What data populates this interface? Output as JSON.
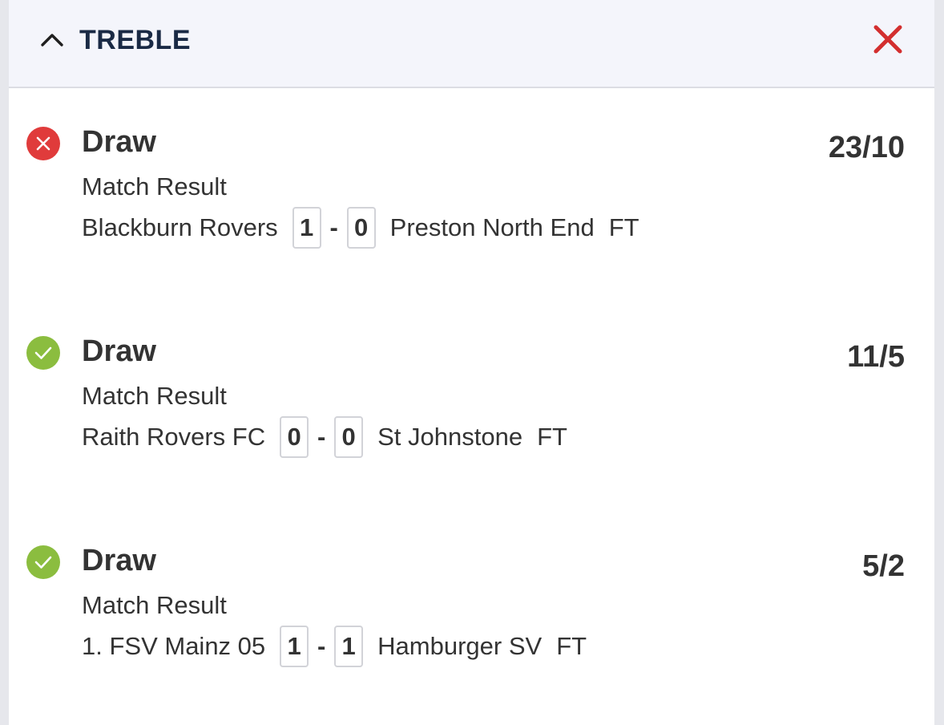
{
  "header": {
    "title": "TREBLE",
    "collapse_icon": "chevron-up-icon",
    "close_icon": "close-icon"
  },
  "colors": {
    "header_title": "#1a2a45",
    "close": "#d32f2f",
    "lost": "#e03b3b",
    "won": "#8bbd3f",
    "text": "#333333"
  },
  "selections": [
    {
      "status": "lost",
      "status_icon": "cross-circle-icon",
      "name": "Draw",
      "odds": "23/10",
      "market": "Match Result",
      "home_team": "Blackburn Rovers",
      "home_score": "1",
      "separator": "-",
      "away_score": "0",
      "away_team": "Preston North End",
      "match_status": "FT"
    },
    {
      "status": "won",
      "status_icon": "check-circle-icon",
      "name": "Draw",
      "odds": "11/5",
      "market": "Match Result",
      "home_team": "Raith Rovers FC",
      "home_score": "0",
      "separator": "-",
      "away_score": "0",
      "away_team": "St Johnstone",
      "match_status": "FT"
    },
    {
      "status": "won",
      "status_icon": "check-circle-icon",
      "name": "Draw",
      "odds": "5/2",
      "market": "Match Result",
      "home_team": "1. FSV Mainz 05",
      "home_score": "1",
      "separator": "-",
      "away_score": "1",
      "away_team": "Hamburger SV",
      "match_status": "FT"
    }
  ]
}
